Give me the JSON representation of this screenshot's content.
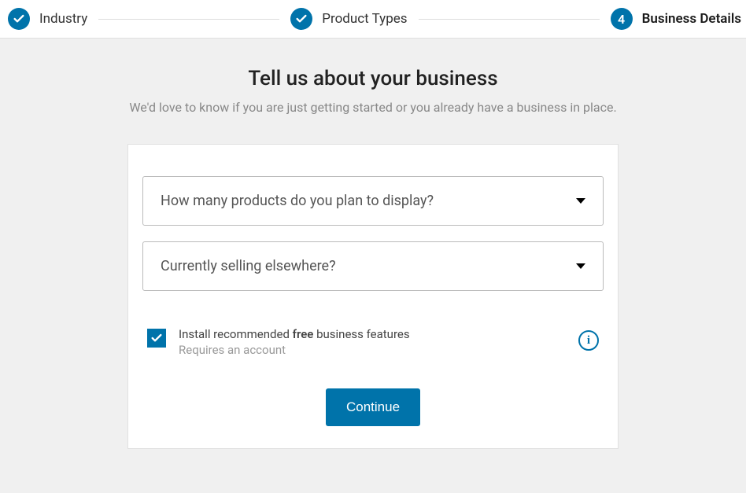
{
  "stepper": {
    "steps": [
      {
        "label": "Industry",
        "completed": true
      },
      {
        "label": "Product Types",
        "completed": true
      },
      {
        "label": "Business Details",
        "number": "4",
        "active": true
      }
    ]
  },
  "header": {
    "title": "Tell us about your business",
    "subtitle": "We'd love to know if you are just getting started or you already have a business in place."
  },
  "form": {
    "products_select_label": "How many products do you plan to display?",
    "selling_select_label": "Currently selling elsewhere?",
    "features": {
      "line_pre": "Install recommended ",
      "line_bold": "free",
      "line_post": " business features",
      "sub": "Requires an account",
      "checked": true
    },
    "continue_label": "Continue"
  }
}
